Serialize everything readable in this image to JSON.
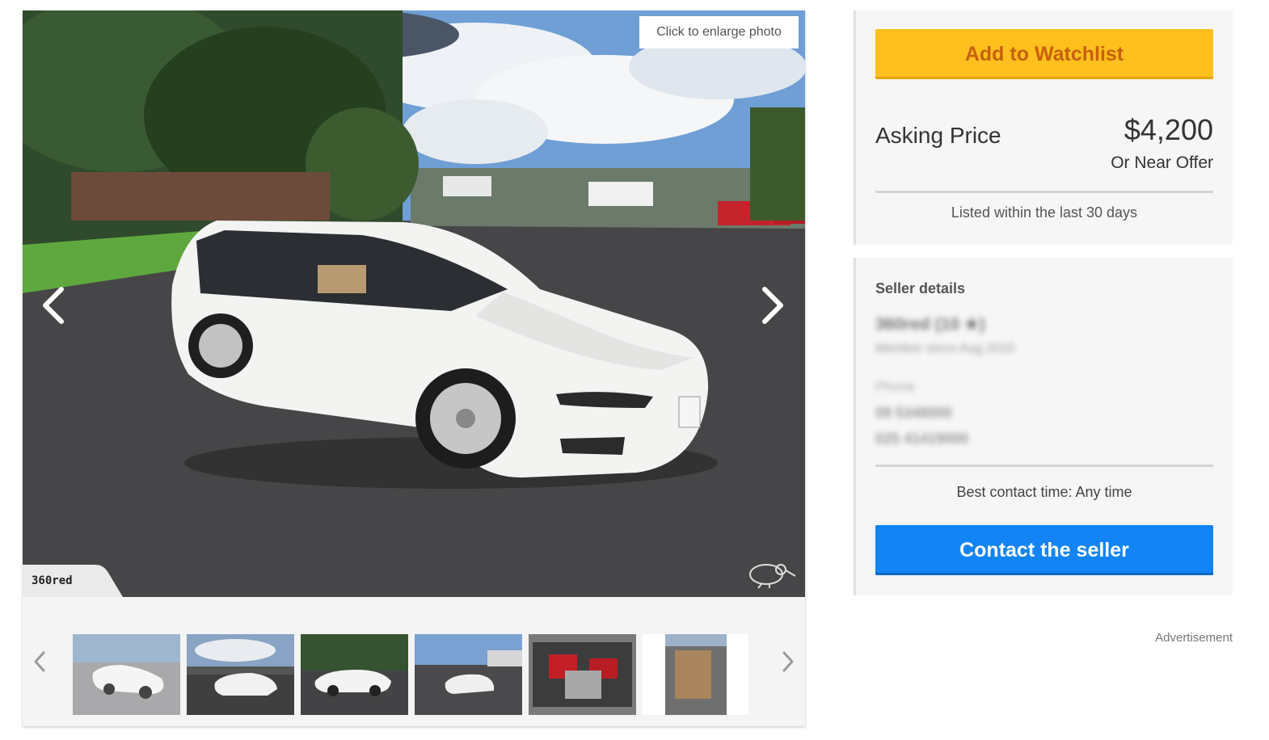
{
  "gallery": {
    "enlarge_tip": "Click to enlarge photo",
    "watermark": "360red",
    "thumbnails": [
      "photo-front-left",
      "photo-rear-left",
      "photo-side-left",
      "photo-rear-right",
      "photo-engine-bay",
      "photo-interior"
    ]
  },
  "listing": {
    "watchlist_label": "Add to Watchlist",
    "asking_label": "Asking Price",
    "price": "$4,200",
    "price_note": "Or Near Offer",
    "listed_text": "Listed within the last 30 days"
  },
  "seller": {
    "title": "Seller details",
    "name": "360red (10 ★)",
    "member_since": "Member since Aug 2010",
    "phone_label": "Phone",
    "phone_1": "09 5348000",
    "phone_2": "025 41419000",
    "contact_time": "Best contact time: Any time",
    "contact_label": "Contact the seller"
  },
  "advertisement_label": "Advertisement",
  "colors": {
    "watch_button": "#ffc01e",
    "contact_button": "#1284f5",
    "card_bg": "#f6f6f6"
  },
  "icons": [
    "chevron-left-icon",
    "chevron-right-icon",
    "kiwi-bird-icon"
  ]
}
